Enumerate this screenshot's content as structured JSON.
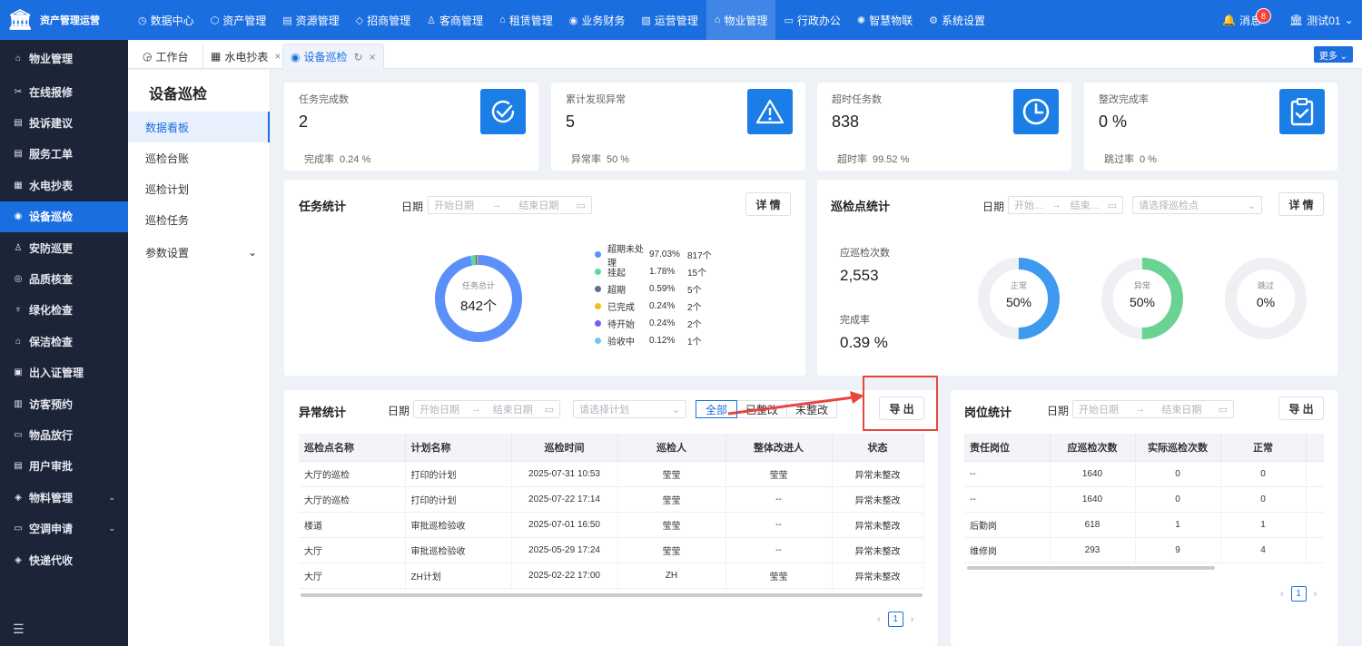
{
  "app": {
    "name": "资产管理运营",
    "message_label": "消息",
    "message_count": "8",
    "user": "测试01"
  },
  "top_nav": [
    {
      "label": "数据中心",
      "icon": "◷"
    },
    {
      "label": "资产管理",
      "icon": "⬡"
    },
    {
      "label": "资源管理",
      "icon": "▤"
    },
    {
      "label": "招商管理",
      "icon": "◇"
    },
    {
      "label": "客商管理",
      "icon": "♙"
    },
    {
      "label": "租赁管理",
      "icon": "⌂"
    },
    {
      "label": "业务财务",
      "icon": "◉"
    },
    {
      "label": "运营管理",
      "icon": "▧"
    },
    {
      "label": "物业管理",
      "icon": "⌂"
    },
    {
      "label": "行政办公",
      "icon": "▭"
    },
    {
      "label": "智慧物联",
      "icon": "✺"
    },
    {
      "label": "系统设置",
      "icon": "⚙"
    }
  ],
  "sidebar": {
    "header": "物业管理",
    "items": [
      {
        "label": "在线报修",
        "icon": "✂"
      },
      {
        "label": "投诉建议",
        "icon": "▤"
      },
      {
        "label": "服务工单",
        "icon": "▤"
      },
      {
        "label": "水电抄表",
        "icon": "▦"
      },
      {
        "label": "设备巡检",
        "icon": "◉"
      },
      {
        "label": "安防巡更",
        "icon": "♙"
      },
      {
        "label": "品质核查",
        "icon": "◎"
      },
      {
        "label": "绿化检查",
        "icon": "♆"
      },
      {
        "label": "保洁检查",
        "icon": "⌂"
      },
      {
        "label": "出入证管理",
        "icon": "▣"
      },
      {
        "label": "访客预约",
        "icon": "▥"
      },
      {
        "label": "物品放行",
        "icon": "▭"
      },
      {
        "label": "用户审批",
        "icon": "▤"
      },
      {
        "label": "物料管理",
        "icon": "◈",
        "chevron": "⌄"
      },
      {
        "label": "空调申请",
        "icon": "▭",
        "chevron": "⌄"
      },
      {
        "label": "快递代收",
        "icon": "◈"
      }
    ]
  },
  "tabs": [
    {
      "label": "工作台",
      "icon": "◶"
    },
    {
      "label": "水电抄表",
      "icon": "▦",
      "close": "×"
    },
    {
      "label": "设备巡检",
      "icon": "◉",
      "refresh": "↻",
      "close": "×"
    }
  ],
  "more_label": "更多 ⌄",
  "subside": {
    "title": "设备巡检",
    "items": [
      "数据看板",
      "巡检台账",
      "巡检计划",
      "巡检任务",
      "参数设置"
    ],
    "chevron": "⌄"
  },
  "stats": [
    {
      "label": "任务完成数",
      "value": "2",
      "sub_label": "完成率",
      "sub_value": "0.24 %",
      "icon": "check-circle-icon"
    },
    {
      "label": "累计发现异常",
      "value": "5",
      "sub_label": "异常率",
      "sub_value": "50 %",
      "icon": "warning-icon"
    },
    {
      "label": "超时任务数",
      "value": "838",
      "sub_label": "超时率",
      "sub_value": "99.52 %",
      "icon": "clock-icon"
    },
    {
      "label": "整改完成率",
      "value": "0 %",
      "sub_label": "跳过率",
      "sub_value": "0 %",
      "icon": "clipboard-check-icon"
    }
  ],
  "task_stats": {
    "title": "任务统计",
    "date_label": "日期",
    "start_placeholder": "开始日期",
    "end_placeholder": "结束日期",
    "arrow": "→",
    "detail_button": "详 情",
    "donut_label": "任务总计",
    "donut_value": "842个",
    "legend": [
      {
        "name": "超期未处理",
        "pct": "97.03%",
        "count": "817个",
        "color": "#5b8ff9",
        "value": 817
      },
      {
        "name": "挂起",
        "pct": "1.78%",
        "count": "15个",
        "color": "#5ad8a6",
        "value": 15
      },
      {
        "name": "超期",
        "pct": "0.59%",
        "count": "5个",
        "color": "#5d7092",
        "value": 5
      },
      {
        "name": "已完成",
        "pct": "0.24%",
        "count": "2个",
        "color": "#f6bd16",
        "value": 2
      },
      {
        "name": "待开始",
        "pct": "0.24%",
        "count": "2个",
        "color": "#6f5ef9",
        "value": 2
      },
      {
        "name": "验收中",
        "pct": "0.12%",
        "count": "1个",
        "color": "#6dc8ec",
        "value": 1
      }
    ]
  },
  "point_stats": {
    "title": "巡检点统计",
    "date_label": "日期",
    "start_placeholder": "开始...",
    "end_placeholder": "结束...",
    "arrow": "→",
    "select_placeholder": "请选择巡检点",
    "detail_button": "详 情",
    "should_label": "应巡检次数",
    "should_value": "2,553",
    "rate_label": "完成率",
    "rate_value": "0.39 %",
    "rings": [
      {
        "label": "正常",
        "value": "50%",
        "fraction": 0.5,
        "color": "#3d9af0"
      },
      {
        "label": "异常",
        "value": "50%",
        "fraction": 0.5,
        "color": "#6ad391"
      },
      {
        "label": "跳过",
        "value": "0%",
        "fraction": 0,
        "color": "#3d9af0"
      }
    ]
  },
  "abnormal": {
    "title": "异常统计",
    "date_label": "日期",
    "start_placeholder": "开始日期",
    "end_placeholder": "结束日期",
    "arrow": "→",
    "select_placeholder": "请选择计划",
    "segments": [
      "全部",
      "已整改",
      "未整改"
    ],
    "export_button": "导 出",
    "columns": [
      "巡检点名称",
      "计划名称",
      "巡检时间",
      "巡检人",
      "整体改进人",
      "状态"
    ],
    "rows": [
      [
        "大厅的巡检",
        "打印的计划",
        "2025-07-31 10:53",
        "莹莹",
        "莹莹",
        "异常未整改"
      ],
      [
        "大厅的巡检",
        "打印的计划",
        "2025-07-22 17:14",
        "莹莹",
        "--",
        "异常未整改"
      ],
      [
        "楼道",
        "审批巡检验收",
        "2025-07-01 16:50",
        "莹莹",
        "--",
        "异常未整改"
      ],
      [
        "大厅",
        "审批巡检验收",
        "2025-05-29 17:24",
        "莹莹",
        "--",
        "异常未整改"
      ],
      [
        "大厅",
        "ZH计划",
        "2025-02-22 17:00",
        "ZH",
        "莹莹",
        "异常未整改"
      ]
    ],
    "page": "1"
  },
  "post": {
    "title": "岗位统计",
    "date_label": "日期",
    "start_placeholder": "开始日期",
    "end_placeholder": "结束日期",
    "arrow": "→",
    "export_button": "导 出",
    "columns": [
      "责任岗位",
      "应巡检次数",
      "实际巡检次数",
      "正常"
    ],
    "rows": [
      [
        "--",
        "1640",
        "0",
        "0"
      ],
      [
        "--",
        "1640",
        "0",
        "0"
      ],
      [
        "后勤岗",
        "618",
        "1",
        "1"
      ],
      [
        "维修岗",
        "293",
        "9",
        "4"
      ]
    ],
    "page": "1"
  },
  "pager": {
    "prev": "‹",
    "next": "›"
  },
  "colors": {
    "primary": "#1b6ee0",
    "sidebar": "#1c2438",
    "highlight": "#e8453c"
  }
}
